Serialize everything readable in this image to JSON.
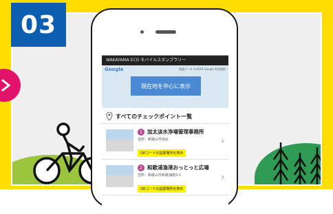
{
  "step_number": "03",
  "colors": {
    "frame": "#ffdd00",
    "badge": "#0c5fb0",
    "arrow": "#e2136b",
    "button": "#4a8ad4",
    "cp_number": "#b8428b",
    "qr_tag": "#fff200"
  },
  "app": {
    "title": "WAKAYAMA ECO モバイルスタンプラリー",
    "map": {
      "logo": "Google",
      "credit": "地図データ ©2019 Google 利用規約",
      "locate_button": "現在地を中心に表示"
    },
    "list_heading": "すべてのチェックポイント一覧",
    "checkpoints": [
      {
        "number": "1",
        "name": "加太淡水浄場管理事務所",
        "address": "住所：和歌山市加太",
        "qr_label": "QRコードの設置場所を表示"
      },
      {
        "number": "2",
        "name": "和歌浦漁港おっとっと広場",
        "address": "住所：和歌山市和歌浦南3-1",
        "qr_label": "QRコードの設置場所を表示"
      }
    ]
  },
  "icons": {
    "arrow": "chevron-right-icon",
    "cyclist": "cyclist-icon",
    "trees": "pine-trees-icon",
    "pin": "map-pin-icon"
  }
}
